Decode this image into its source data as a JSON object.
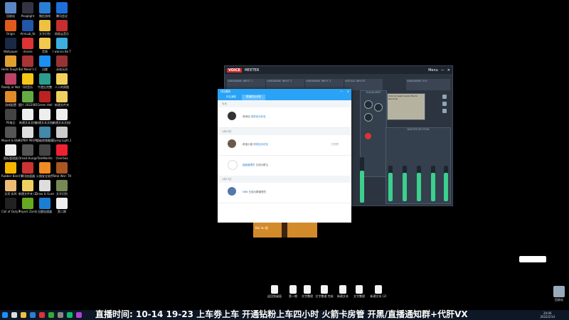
{
  "desktop": {
    "icons": [
      {
        "label": "回收站",
        "color": "#5b86c5"
      },
      {
        "label": "Peaglight",
        "color": "#334"
      },
      {
        "label": "微信游戏",
        "color": "#2a7fd4"
      },
      {
        "label": "腾讯会议",
        "color": "#1e6fd9"
      },
      {
        "label": "Origin",
        "color": "#e05a1d"
      },
      {
        "label": "AimLab_tb",
        "color": "#2256a6"
      },
      {
        "label": "文字识别",
        "color": "#f0c040"
      },
      {
        "label": "网易云音乐",
        "color": "#c62f2f"
      },
      {
        "label": "Wallpaper",
        "color": "#1b2a44"
      },
      {
        "label": "dnosie",
        "color": "#d33"
      },
      {
        "label": "音频",
        "color": "#f2c94c"
      },
      {
        "label": "I wanna Be The Cat",
        "color": "#3bb0e0"
      },
      {
        "label": "Hello Tough Life",
        "color": "#e0a030"
      },
      {
        "label": "Sid Meier's Civilizatio...",
        "color": "#a33"
      },
      {
        "label": "迅雷",
        "color": "#1d8ff0"
      },
      {
        "label": "永劫无间",
        "color": "#933"
      },
      {
        "label": "Ready or Not",
        "color": "#b46"
      },
      {
        "label": "QQ音乐",
        "color": "#f5c518"
      },
      {
        "label": "牛遗忘完整",
        "color": "#2a9d8f"
      },
      {
        "label": "人人的原图",
        "color": "#f2d25a"
      },
      {
        "label": "游戏配置",
        "color": "#e08a2a"
      },
      {
        "label": "图片 20220811",
        "color": "#6a4"
      },
      {
        "label": "Green Hell",
        "color": "#b22"
      },
      {
        "label": "新建文件夹",
        "color": "#f0d060"
      },
      {
        "label": "PS笔记",
        "color": "#444"
      },
      {
        "label": "新建文本文档",
        "color": "#eee"
      },
      {
        "label": "新建文本文档(3)",
        "color": "#eee"
      },
      {
        "label": "新建文本文档(2)",
        "color": "#eee"
      },
      {
        "label": "Mount & Blade II",
        "color": "#555"
      },
      {
        "label": "SUPER PEOPLE CBT",
        "color": "#ddd"
      },
      {
        "label": "超级视频截图",
        "color": "#48a"
      },
      {
        "label": "Dying Light 2",
        "color": "#ccc"
      },
      {
        "label": "图标管理器",
        "color": "#eee"
      },
      {
        "label": "Dread Hunger",
        "color": "#555"
      },
      {
        "label": "TaleWorlds",
        "color": "#444"
      },
      {
        "label": "OverSea",
        "color": "#e23"
      },
      {
        "label": "Rubber Bandits",
        "color": "#f7b500"
      },
      {
        "label": "腾讯加速器",
        "color": "#c33"
      },
      {
        "label": "火绒安全软件",
        "color": "#f08a24"
      },
      {
        "label": "Total War: THREE KI...",
        "color": "#a52"
      },
      {
        "label": "无忧·实时",
        "color": "#eb7"
      },
      {
        "label": "新建文件夹 (2)",
        "color": "#f0d060"
      },
      {
        "label": "Draw & Guess",
        "color": "#ddd"
      },
      {
        "label": "文字识别",
        "color": "#785"
      },
      {
        "label": "Call of Duty Modern...",
        "color": "#222"
      },
      {
        "label": "Project Zomboid",
        "color": "#6a2"
      },
      {
        "label": "迅雷加速器",
        "color": "#1a7fd4"
      },
      {
        "label": "第二期",
        "color": "#eee"
      }
    ]
  },
  "voicemeeter": {
    "logo": "VOICE",
    "logo2": "MEETER",
    "strips": [
      {
        "label": "HARDWARE INPUT 1"
      },
      {
        "label": "HARDWARE INPUT 2"
      },
      {
        "label": "HARDWARE INPUT 3"
      },
      {
        "label": "VIRTUAL INPUTS"
      },
      {
        "label": "HARDWARE OUT"
      }
    ],
    "menu": "Menu",
    "master": "MASTER SECTION",
    "equalizer": "EQUALIZER",
    "tape": "Click to Select Audio file for Recorder"
  },
  "chat": {
    "window_title": "QQ通知",
    "tabs": [
      "好友通知",
      "群通知及消息"
    ],
    "notifications": [
      {
        "date": "今天",
        "name": "请添加",
        "action": "请求加为好友",
        "time": ""
      },
      {
        "date": "1月12日",
        "name": "希温小猫",
        "action": "请求加为好友",
        "time": "已同意"
      },
      {
        "date": "",
        "name": "超级管理员",
        "action": "已成为群主",
        "time": ""
      },
      {
        "date": "1月11日",
        "name": "NBB",
        "action": "已成为群管理员",
        "time": ""
      }
    ]
  },
  "orange_banner": {
    "brand": "Bai du 图"
  },
  "desktop_files": [
    {
      "label": "返回到桌面"
    },
    {
      "label": "第一期"
    },
    {
      "label": "文字整理"
    },
    {
      "label": "文字整理 完成"
    },
    {
      "label": "新建文本"
    },
    {
      "label": "文字整理"
    },
    {
      "label": "新建文本 (2)"
    }
  ],
  "recycle": {
    "label": "回收站"
  },
  "marquee": "直播时间: 10-14 19-23 上车劵上车 开通钻粉上车四小时 火箭卡房管 开黑/直播通知群+代肝VX",
  "clock": {
    "time": "20:06",
    "date": "2022/2/14"
  }
}
